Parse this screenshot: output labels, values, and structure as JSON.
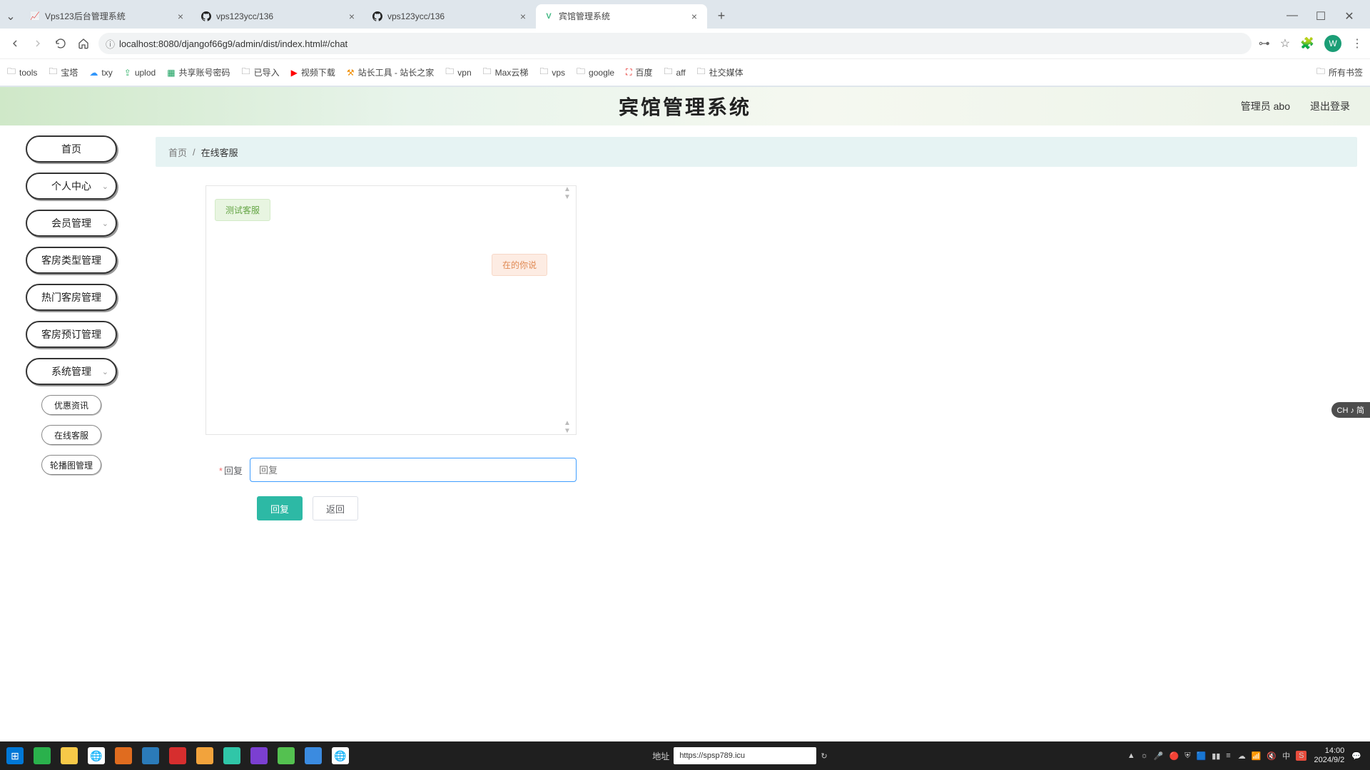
{
  "browser": {
    "tabs": [
      {
        "title": "Vps123后台管理系统",
        "favicon": "📊",
        "active": false
      },
      {
        "title": "vps123ycc/136",
        "favicon": "gh",
        "active": false
      },
      {
        "title": "vps123ycc/136",
        "favicon": "gh",
        "active": false
      },
      {
        "title": "宾馆管理系统",
        "favicon": "V",
        "active": true
      }
    ],
    "url": "localhost:8080/djangof66g9/admin/dist/index.html#/chat",
    "bookmarks": [
      {
        "icon": "folder",
        "label": "tools"
      },
      {
        "icon": "folder",
        "label": "宝塔"
      },
      {
        "icon": "txy",
        "label": "txy"
      },
      {
        "icon": "uplod",
        "label": "uplod"
      },
      {
        "icon": "sheet",
        "label": "共享账号密码"
      },
      {
        "icon": "folder",
        "label": "已导入"
      },
      {
        "icon": "yt",
        "label": "视频下载"
      },
      {
        "icon": "tool",
        "label": "站长工具 - 站长之家"
      },
      {
        "icon": "folder",
        "label": "vpn"
      },
      {
        "icon": "folder",
        "label": "Max云梯"
      },
      {
        "icon": "folder",
        "label": "vps"
      },
      {
        "icon": "folder",
        "label": "google"
      },
      {
        "icon": "baidu",
        "label": "百度"
      },
      {
        "icon": "folder",
        "label": "aff"
      },
      {
        "icon": "folder",
        "label": "社交媒体"
      }
    ],
    "bookmarks_tail": "所有书签",
    "profile_letter": "W",
    "win_min": "—",
    "win_max": "☐",
    "win_close": "✕"
  },
  "app": {
    "title": "宾馆管理系统",
    "admin_label": "管理员 abo",
    "logout_label": "退出登录",
    "breadcrumb": {
      "home": "首页",
      "sep": "/",
      "current": "在线客服"
    },
    "sidebar": [
      {
        "label": "首页",
        "expandable": false
      },
      {
        "label": "个人中心",
        "expandable": true
      },
      {
        "label": "会员管理",
        "expandable": true
      },
      {
        "label": "客房类型管理",
        "expandable": false
      },
      {
        "label": "热门客房管理",
        "expandable": false
      },
      {
        "label": "客房预订管理",
        "expandable": false
      },
      {
        "label": "系统管理",
        "expandable": true
      }
    ],
    "sidebar_sub": [
      {
        "label": "优惠资讯"
      },
      {
        "label": "在线客服"
      },
      {
        "label": "轮播图管理"
      }
    ],
    "chat": {
      "messages": [
        {
          "side": "left",
          "text": "测试客服"
        },
        {
          "side": "right",
          "text": "在的你说"
        }
      ]
    },
    "reply": {
      "label": "回复",
      "placeholder": "回复",
      "submit_label": "回复",
      "back_label": "返回"
    }
  },
  "ime_badge": "CH ♪ 简",
  "taskbar": {
    "addr_label": "地址",
    "addr_value": "https://spsp789.icu",
    "tray_icons": [
      "▲",
      "☼",
      "🎤",
      "🔴",
      "⛨",
      "🟦",
      "▮▮",
      "≡"
    ],
    "sys_icons": [
      "☁",
      "📶",
      "🔇",
      "中",
      "S"
    ],
    "clock_time": "14:00",
    "clock_date": "2024/9/2",
    "notif": "💬",
    "app_colors": [
      "#0078d7",
      "#2ab14c",
      "#f7c948",
      "#ffffff",
      "#e06c1f",
      "#2b7bb9",
      "#d62e2e",
      "#f2a33c",
      "#30c6a8",
      "#7b3fd1",
      "#54c150",
      "#3b8be0",
      "#ffffff"
    ]
  }
}
